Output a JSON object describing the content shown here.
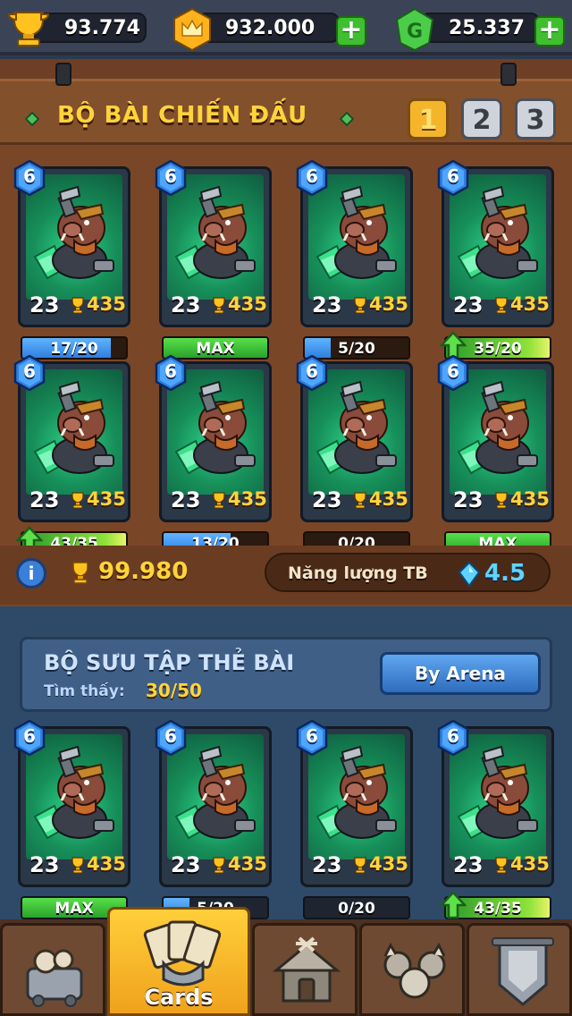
{
  "resources": {
    "trophies": "93.774",
    "gold": "932.000",
    "gems": "25.337",
    "plus_label": "+"
  },
  "deck": {
    "title": "BỘ BÀI CHIẾN ĐẤU",
    "tabs": [
      "1",
      "2",
      "3"
    ],
    "active_tab": "1",
    "cards": [
      {
        "level": "6",
        "count": "23",
        "cost": "435",
        "progress": "17/20",
        "fill": 0.85,
        "type": "blue",
        "upgrade": false
      },
      {
        "level": "6",
        "count": "23",
        "cost": "435",
        "progress": "MAX",
        "fill": 1.0,
        "type": "green",
        "upgrade": false
      },
      {
        "level": "6",
        "count": "23",
        "cost": "435",
        "progress": "5/20",
        "fill": 0.25,
        "type": "blue",
        "upgrade": false
      },
      {
        "level": "6",
        "count": "23",
        "cost": "435",
        "progress": "35/20",
        "fill": 1.0,
        "type": "upgrade",
        "upgrade": true
      },
      {
        "level": "6",
        "count": "23",
        "cost": "435",
        "progress": "43/35",
        "fill": 1.0,
        "type": "upgrade",
        "upgrade": true
      },
      {
        "level": "6",
        "count": "23",
        "cost": "435",
        "progress": "13/20",
        "fill": 0.65,
        "type": "blue",
        "upgrade": false
      },
      {
        "level": "6",
        "count": "23",
        "cost": "435",
        "progress": "0/20",
        "fill": 0.0,
        "type": "blue",
        "upgrade": false
      },
      {
        "level": "6",
        "count": "23",
        "cost": "435",
        "progress": "MAX",
        "fill": 1.0,
        "type": "green",
        "upgrade": false
      }
    ],
    "total_trophies": "99.980",
    "info_label": "i",
    "energy_label": "Năng lượng TB",
    "energy_value": "4.5"
  },
  "collection": {
    "title": "BỘ SƯU TẬP THẺ BÀI",
    "found_label": "Tìm thấy:",
    "found_value": "30/50",
    "sort_button": "By Arena",
    "cards": [
      {
        "level": "6",
        "count": "23",
        "cost": "435",
        "progress": "MAX",
        "fill": 1.0,
        "type": "green",
        "upgrade": false
      },
      {
        "level": "6",
        "count": "23",
        "cost": "435",
        "progress": "5/20",
        "fill": 0.25,
        "type": "blue",
        "upgrade": false
      },
      {
        "level": "6",
        "count": "23",
        "cost": "435",
        "progress": "0/20",
        "fill": 0.0,
        "type": "blue",
        "upgrade": false
      },
      {
        "level": "6",
        "count": "23",
        "cost": "435",
        "progress": "43/35",
        "fill": 1.0,
        "type": "upgrade",
        "upgrade": true
      }
    ]
  },
  "nav": {
    "items": [
      {
        "name": "shop",
        "label": ""
      },
      {
        "name": "cards",
        "label": "Cards",
        "active": true
      },
      {
        "name": "battle",
        "label": ""
      },
      {
        "name": "clan",
        "label": ""
      },
      {
        "name": "events",
        "label": ""
      }
    ]
  }
}
